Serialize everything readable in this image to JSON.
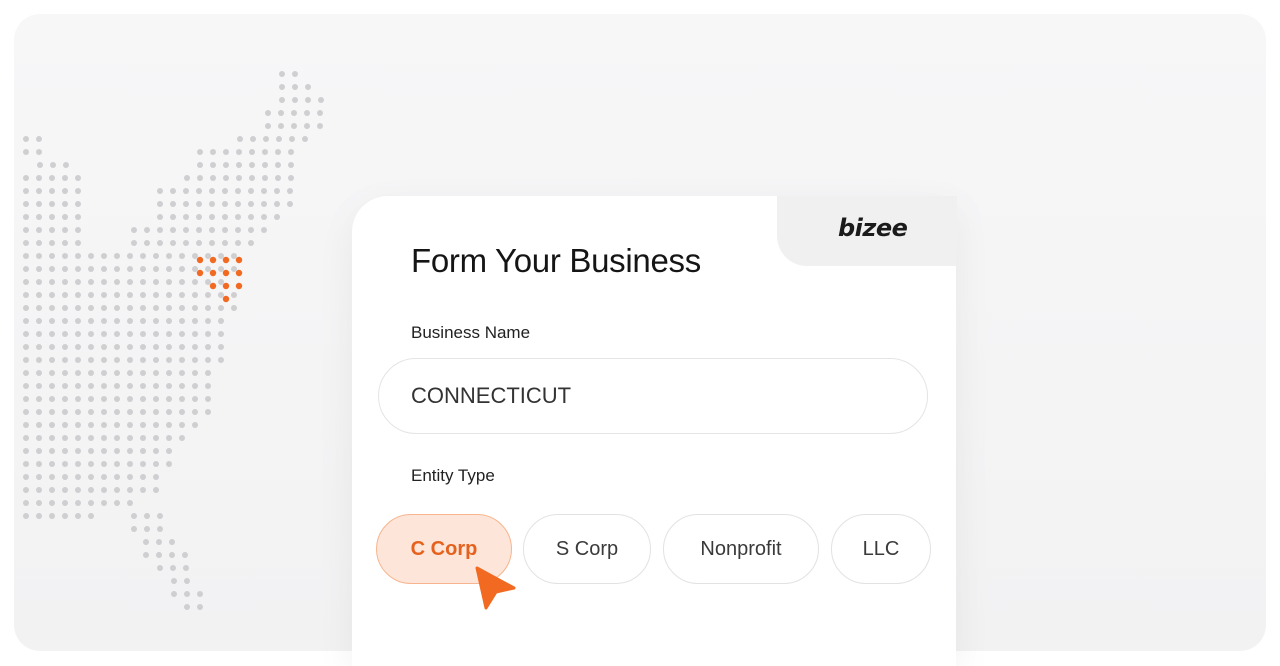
{
  "brand": {
    "logo_text": "bizee"
  },
  "form": {
    "title": "Form Your Business",
    "business_name_label": "Business Name",
    "business_name_value": "CONNECTICUT",
    "entity_type_label": "Entity Type",
    "entity_types": [
      "C Corp",
      "S Corp",
      "Nonprofit",
      "LLC"
    ],
    "selected_entity": "C Corp"
  },
  "colors": {
    "accent": "#f26a21",
    "accent_bg": "#fde6d9",
    "map_dot": "#cfcfd2"
  },
  "icons": [
    "cursor-pointer-icon",
    "us-dot-map"
  ]
}
